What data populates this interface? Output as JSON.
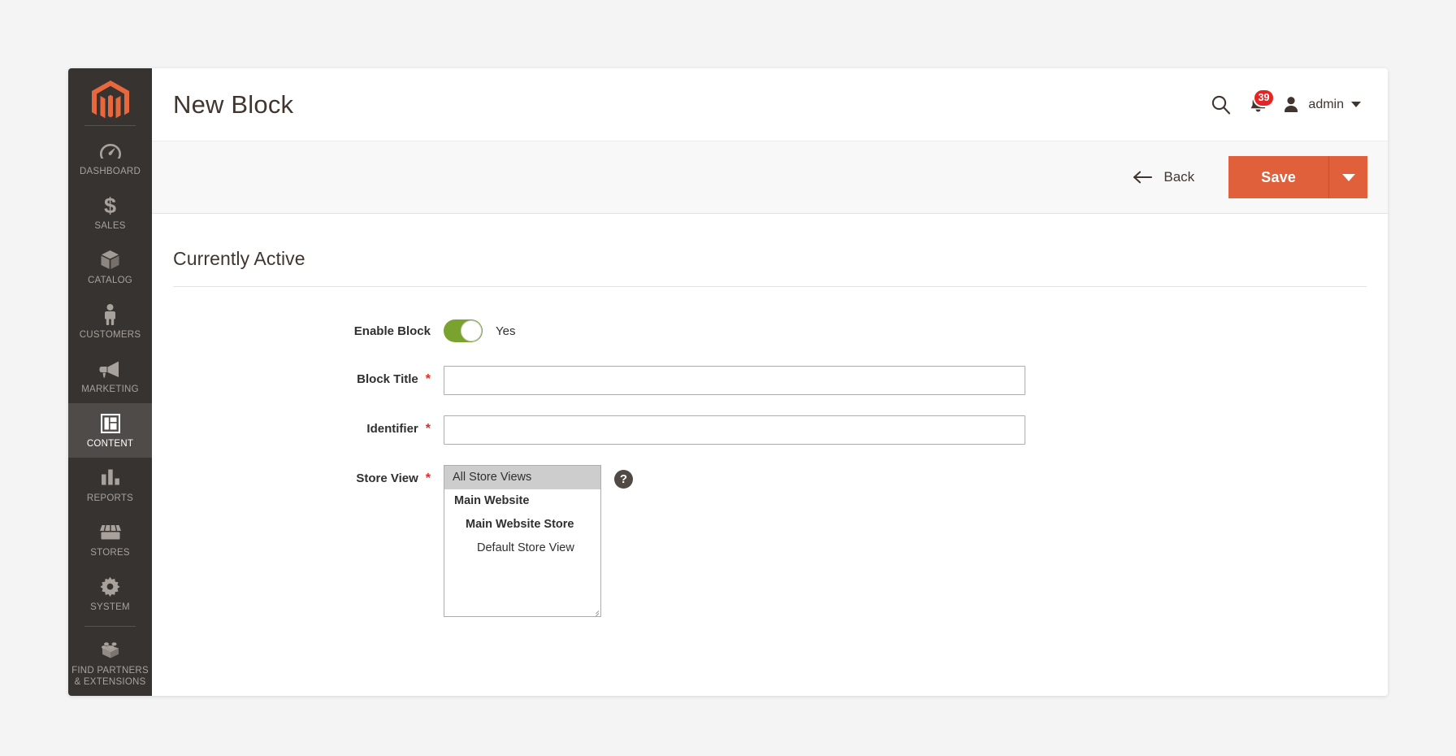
{
  "sidebar": {
    "logo": "magento-logo",
    "items": [
      {
        "label": "DASHBOARD",
        "icon": "dashboard-gauge-icon",
        "active": false
      },
      {
        "label": "SALES",
        "icon": "dollar-sign-icon",
        "active": false
      },
      {
        "label": "CATALOG",
        "icon": "box-icon",
        "active": false
      },
      {
        "label": "CUSTOMERS",
        "icon": "person-icon",
        "active": false
      },
      {
        "label": "MARKETING",
        "icon": "megaphone-icon",
        "active": false
      },
      {
        "label": "CONTENT",
        "icon": "layout-blocks-icon",
        "active": true
      },
      {
        "label": "REPORTS",
        "icon": "bar-chart-icon",
        "active": false
      },
      {
        "label": "STORES",
        "icon": "storefront-icon",
        "active": false
      },
      {
        "label": "SYSTEM",
        "icon": "gear-icon",
        "active": false
      }
    ],
    "footer_item": {
      "label_line1": "FIND PARTNERS",
      "label_line2": "& EXTENSIONS",
      "icon": "lego-brick-icon"
    }
  },
  "header": {
    "title": "New Block",
    "search_icon": "search-icon",
    "notifications": {
      "icon": "bell-icon",
      "count": "39"
    },
    "account": {
      "avatar_icon": "user-avatar-icon",
      "name": "admin",
      "caret_icon": "chevron-down-icon"
    }
  },
  "toolbar": {
    "back_label": "Back",
    "back_icon": "arrow-left-icon",
    "save_label": "Save",
    "save_dropdown_icon": "caret-down-icon",
    "accent_color": "#e0603b"
  },
  "form": {
    "section_title": "Currently Active",
    "required_marker": "*",
    "fields": {
      "enable_block": {
        "label": "Enable Block",
        "toggle_state": "on",
        "toggle_text": "Yes",
        "toggle_color": "#79a22e"
      },
      "block_title": {
        "label": "Block Title",
        "value": "",
        "placeholder": "",
        "required": true
      },
      "identifier": {
        "label": "Identifier",
        "value": "",
        "placeholder": "",
        "required": true
      },
      "store_view": {
        "label": "Store View",
        "required": true,
        "help_icon": "question-mark-icon",
        "options": [
          {
            "label": "All Store Views",
            "level": 0,
            "selected": true
          },
          {
            "label": "Main Website",
            "level": 1,
            "selected": false
          },
          {
            "label": "Main Website Store",
            "level": 2,
            "selected": false
          },
          {
            "label": "Default Store View",
            "level": 3,
            "selected": false
          }
        ]
      }
    }
  }
}
